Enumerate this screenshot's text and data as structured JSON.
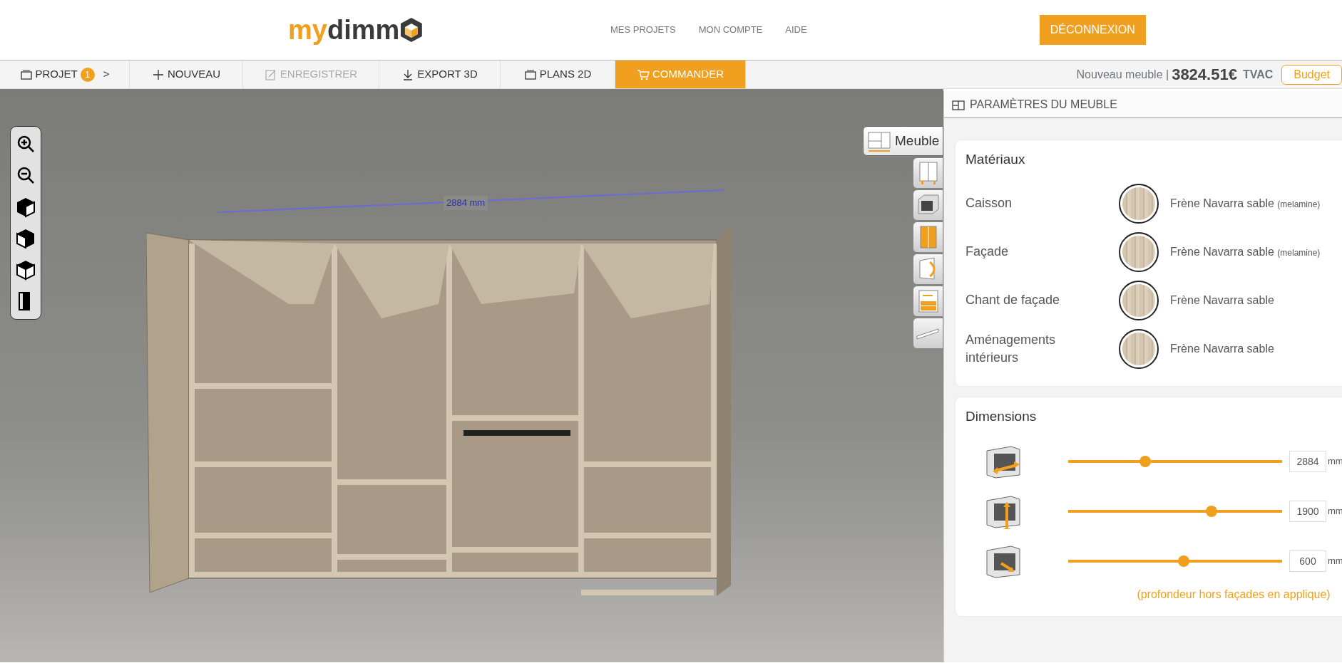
{
  "header": {
    "logo": {
      "part_1": "my",
      "part_2": "dimm"
    },
    "nav_links": [
      "MES PROJETS",
      "MON COMPTE",
      "AIDE"
    ],
    "logout_button": "DÉCONNEXION"
  },
  "toolbar": {
    "items": [
      {
        "kind": "project",
        "label": "PROJET",
        "badge": "1",
        "chevron": ">",
        "disabled": false,
        "selected": false
      },
      {
        "kind": "new",
        "label": "NOUVEAU",
        "disabled": false,
        "selected": false
      },
      {
        "kind": "save",
        "label": "ENREGISTRER",
        "disabled": true,
        "selected": false
      },
      {
        "kind": "export",
        "label": "EXPORT 3D",
        "disabled": false,
        "selected": false
      },
      {
        "kind": "plans",
        "label": "PLANS 2D",
        "disabled": false,
        "selected": false
      },
      {
        "kind": "cart",
        "label": "COMMANDER",
        "disabled": false,
        "selected": true
      }
    ],
    "furniture_name": "Nouveau meuble |",
    "price": "3824.51€",
    "tax": "TVAC",
    "budget_button": "Budget"
  },
  "viewport": {
    "dimension_label": "2884 mm"
  },
  "side_tabs": [
    {
      "kind": "furniture",
      "label": "Meuble",
      "selected": true
    },
    {
      "kind": "doors",
      "selected": false
    },
    {
      "kind": "box",
      "selected": false
    },
    {
      "kind": "facade",
      "selected": false
    },
    {
      "kind": "opening",
      "selected": false
    },
    {
      "kind": "interior",
      "selected": false
    },
    {
      "kind": "shelf",
      "selected": false
    }
  ],
  "panel": {
    "title": "PARAMÈTRES DU MEUBLE",
    "materials": {
      "title": "Matériaux",
      "rows": [
        {
          "label": "Caisson",
          "value": "Frène Navarra sable",
          "note": "(melamine)"
        },
        {
          "label": "Façade",
          "value": "Frène Navarra sable",
          "note": "(melamine)"
        },
        {
          "label": "Chant de façade",
          "value": "Frène Navarra sable"
        },
        {
          "label": "Aménagements intérieurs",
          "value": "Frène Navarra sable"
        }
      ]
    },
    "dimensions": {
      "title": "Dimensions",
      "rows": [
        {
          "kind": "width",
          "level": 0.36,
          "value": "2884",
          "unit": "mm"
        },
        {
          "kind": "height",
          "level": 0.67,
          "value": "1900",
          "unit": "mm"
        },
        {
          "kind": "depth",
          "level": 0.54,
          "value": "600",
          "unit": "mm"
        }
      ],
      "note": "(profondeur hors façades en applique)"
    }
  }
}
